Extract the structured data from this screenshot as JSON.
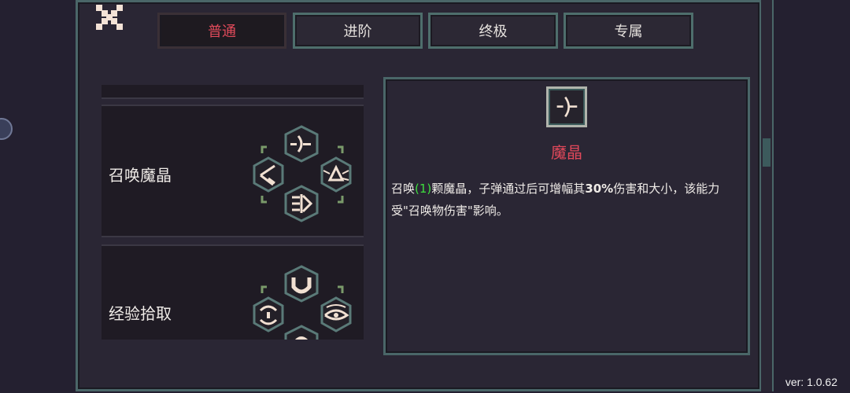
{
  "tabs": [
    {
      "label": "普通",
      "active": true
    },
    {
      "label": "进阶",
      "active": false
    },
    {
      "label": "终极",
      "active": false
    },
    {
      "label": "专属",
      "active": false
    }
  ],
  "skills": [
    {
      "name": "召唤魔晶",
      "icons": [
        "crystal-icon",
        "prism-icon",
        "laser-icon",
        "reflect-icon"
      ]
    },
    {
      "name": "经验拾取",
      "icons": [
        "magnet-icon",
        "eye-icon",
        "magnet-small-icon",
        "cycle-icon"
      ]
    }
  ],
  "detail": {
    "title": "魔晶",
    "icon": "crystal-icon",
    "desc_pre": "召唤",
    "desc_count": "(1)",
    "desc_mid": "颗魔晶，子弹通过后可增幅其",
    "desc_pct": "30%",
    "desc_post": "伤害和大小，该能力受\"召唤物伤害\"影响。"
  },
  "colors": {
    "accent_red": "#e04a5a",
    "highlight_green": "#3ede3e",
    "frame": "#4a6668"
  },
  "version": "ver: 1.0.62"
}
